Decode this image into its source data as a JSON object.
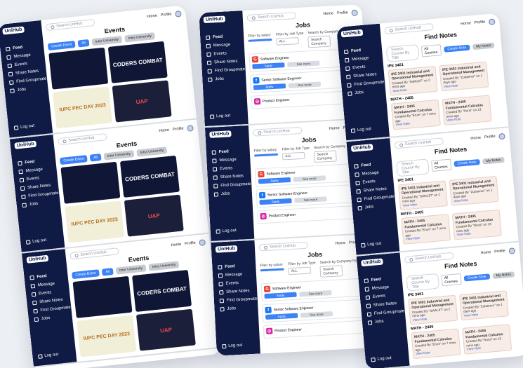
{
  "app": {
    "logo": "UniHub",
    "search_placeholder": "Search UniHub",
    "home_label": "Home",
    "profile_label": "Profile",
    "logout_label": "Log out",
    "nav": [
      "Feed",
      "Message",
      "Events",
      "Share Notes",
      "Find Groupmate",
      "Jobs"
    ]
  },
  "events": {
    "title": "Events",
    "chips": [
      "Create Event",
      "All",
      "Inter University",
      "Intra University"
    ],
    "posters": [
      "CODERS COMBAT",
      "IUPC PEC DAY 2023",
      "UAP"
    ]
  },
  "jobs": {
    "title": "Jobs",
    "filter_salary": "Filter by salary",
    "filter_job_type": "Filter by Job Type",
    "filter_company": "Search by Company Name",
    "job_type_value": "ALL",
    "company_placeholder": "Search Company",
    "listings": [
      {
        "role": "Software Engineer",
        "company": "Google",
        "apply": "Apply",
        "see_more": "See more"
      },
      {
        "role": "Senior Software Engineer",
        "company": "Meta",
        "apply": "Apply",
        "see_more": "See more"
      },
      {
        "role": "Product Engineer",
        "company": "Instagram",
        "apply": "Apply",
        "see_more": "See more"
      }
    ]
  },
  "notes": {
    "title": "Find Notes",
    "search_placeholder": "Search Course By Title",
    "filter_value": "All Courses",
    "create_label": "Create Note",
    "my_notes_label": "My Notes",
    "sections": [
      {
        "name": "IPE 3401",
        "cards": [
          {
            "title": "IPE 3401 Industrial and Operational Management",
            "meta": "Created By \"SWAL87\" on 2 mins ago",
            "view": "View Note"
          },
          {
            "title": "IPE 3401 Industrial and Operational Management",
            "meta": "Created By \"Zubaenur\" on 1 days ago",
            "view": "View Note"
          }
        ]
      },
      {
        "name": "MATH - 2405",
        "cards": [
          {
            "title": "MATH - 2405 Fundamental Calculus",
            "meta": "Created By \"Erum\" on 7 mins ago",
            "view": "View Note"
          },
          {
            "title": "MATH - 2405 Fundamental Calculus",
            "meta": "Created By \"Nurul\" on 13 mins ago",
            "view": "View Note"
          }
        ]
      }
    ]
  },
  "colors": {
    "sidebar": "#0f1a45",
    "accent": "#3b82f6"
  }
}
